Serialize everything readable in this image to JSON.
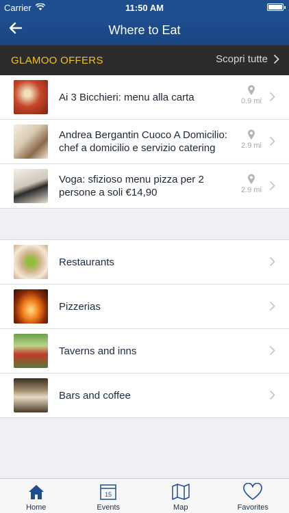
{
  "status": {
    "carrier": "Carrier",
    "time": "11:50 AM"
  },
  "nav": {
    "title": "Where to Eat"
  },
  "offers": {
    "label": "GLAMOO OFFERS",
    "see_all": "Scopri tutte",
    "items": [
      {
        "title": "Ai 3 Bicchieri: menu alla carta",
        "distance": "0.9 mi"
      },
      {
        "title": "Andrea Bergantin Cuoco A Domicilio: chef a domicilio e servizio catering",
        "distance": "2.9 mi"
      },
      {
        "title": "Voga: sfizioso menu pizza per 2 persone a soli €14,90",
        "distance": "2.9 mi"
      }
    ]
  },
  "categories": [
    {
      "label": "Restaurants"
    },
    {
      "label": "Pizzerias"
    },
    {
      "label": "Taverns and inns"
    },
    {
      "label": "Bars and coffee"
    }
  ],
  "tabs": [
    {
      "label": "Home",
      "icon": "home-icon"
    },
    {
      "label": "Events",
      "icon": "calendar-icon",
      "badge": "15"
    },
    {
      "label": "Map",
      "icon": "map-icon"
    },
    {
      "label": "Favorites",
      "icon": "heart-icon"
    }
  ],
  "colors": {
    "navbar": "#1f4e90",
    "offers_label": "#f4c21b",
    "offers_bar": "#2c2c2c",
    "accent": "#1f4e90"
  }
}
